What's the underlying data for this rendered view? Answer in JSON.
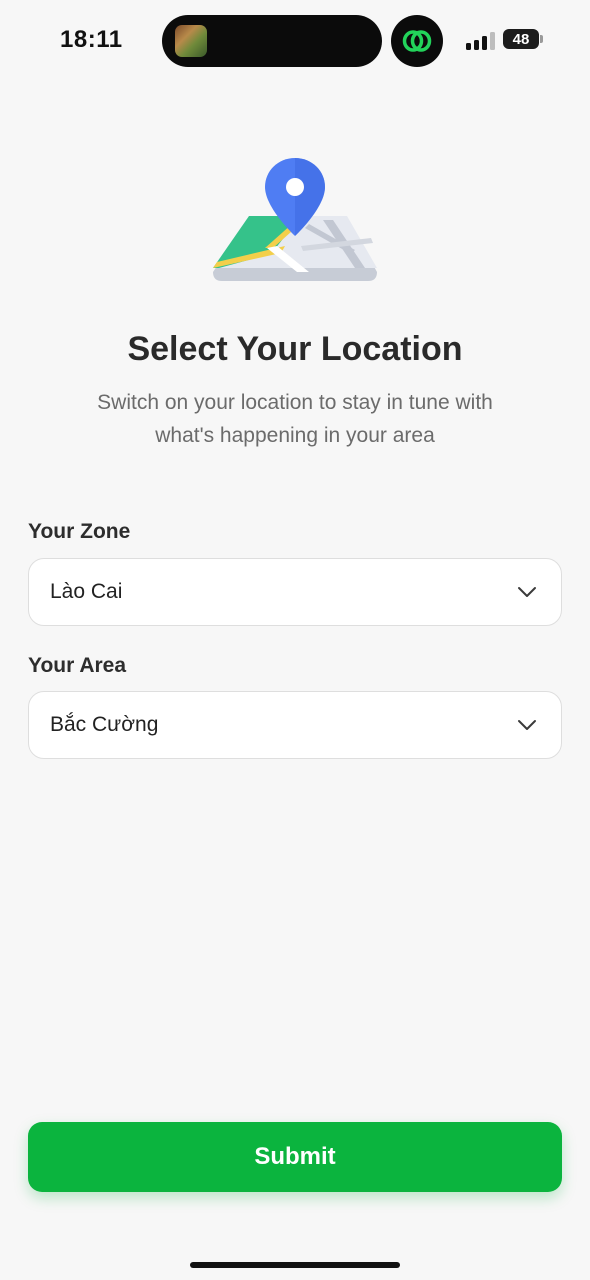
{
  "status_bar": {
    "time": "18:11",
    "battery": "48"
  },
  "colors": {
    "accent_green": "#0bb43e",
    "background": "#f7f7f7",
    "pin_blue": "#4f7df3"
  },
  "header": {
    "illustration_icon": "map-pin-icon",
    "title": "Select Your Location",
    "subtitle": "Switch on your location to stay in tune with what's happening in your area"
  },
  "form": {
    "zone": {
      "label": "Your Zone",
      "value": "Lào Cai",
      "icon": "chevron-down-icon"
    },
    "area": {
      "label": "Your Area",
      "value": "Bắc Cường",
      "icon": "chevron-down-icon"
    }
  },
  "actions": {
    "submit_label": "Submit"
  }
}
